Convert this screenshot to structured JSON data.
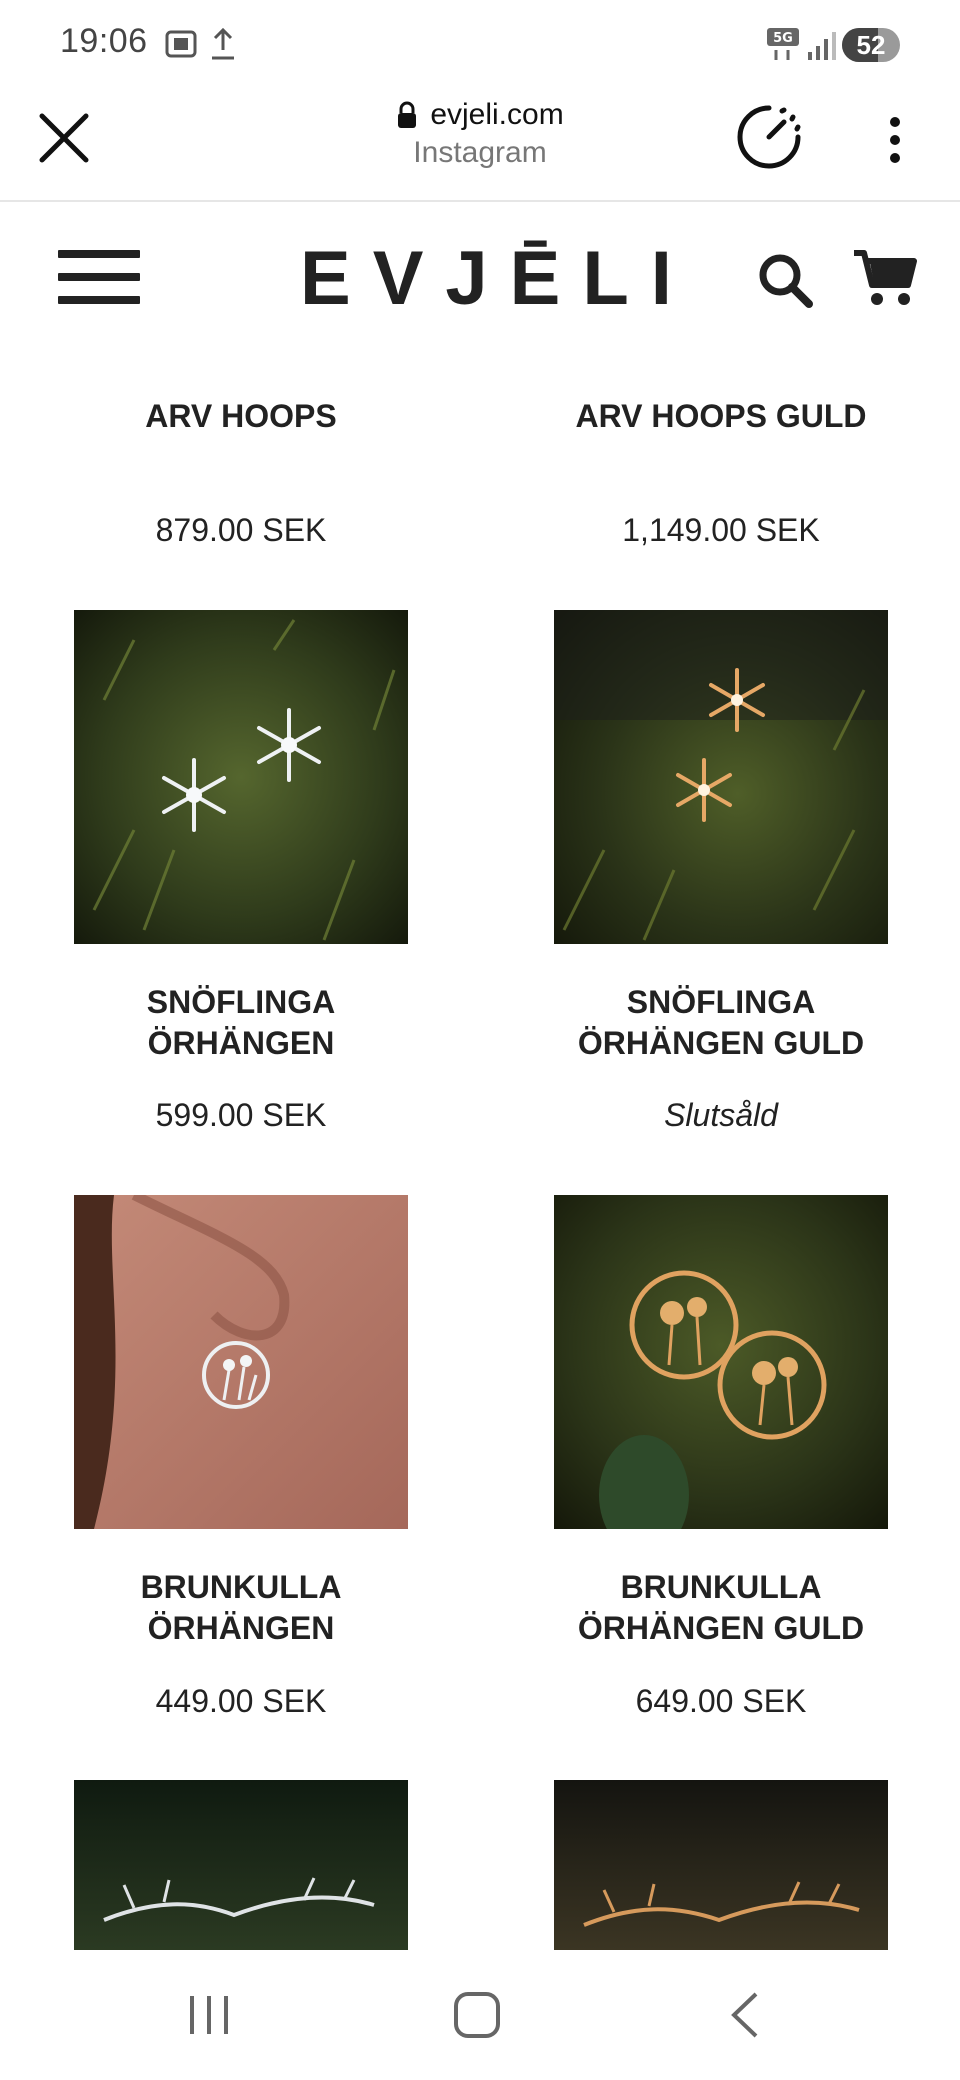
{
  "status": {
    "time": "19:06",
    "network": "5G",
    "battery": "52"
  },
  "browser": {
    "domain": "evjeli.com",
    "source": "Instagram"
  },
  "site": {
    "logo": "EVJĒLI"
  },
  "products": [
    {
      "name": "ARV HOOPS",
      "price": "879.00 SEK"
    },
    {
      "name": "ARV HOOPS GULD",
      "price": "1,149.00 SEK"
    },
    {
      "name": "SNÖFLINGA ÖRHÄNGEN",
      "price": "599.00 SEK"
    },
    {
      "name": "SNÖFLINGA ÖRHÄNGEN GULD",
      "price": "Slutsåld"
    },
    {
      "name": "BRUNKULLA ÖRHÄNGEN",
      "price": "449.00 SEK"
    },
    {
      "name": "BRUNKULLA ÖRHÄNGEN GULD",
      "price": "649.00 SEK"
    }
  ],
  "colors": {
    "text": "#222222",
    "moss_green": "#3a4a22",
    "skin": "#b87a6a",
    "silver": "#e8ecef",
    "gold": "#e0a260"
  }
}
